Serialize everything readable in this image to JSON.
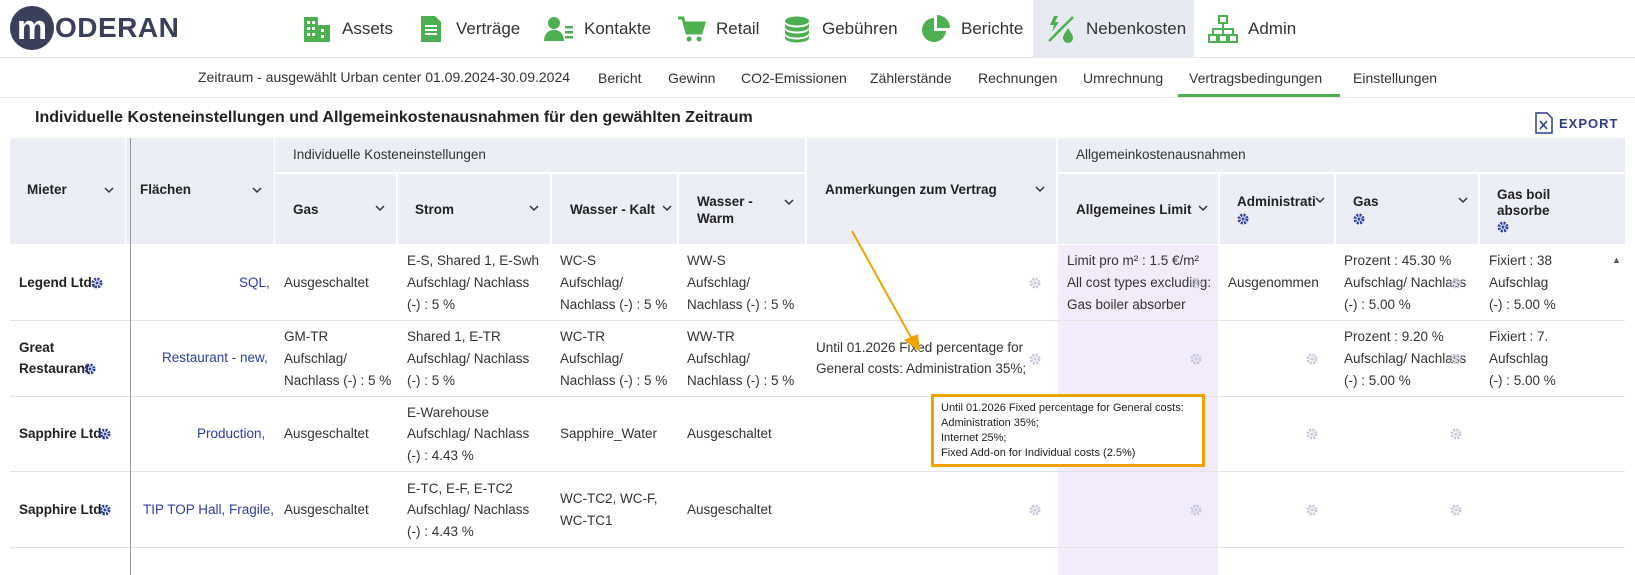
{
  "nav": {
    "logo_letter": "m",
    "logo_text": "ODERAN",
    "items": [
      {
        "label": "Assets",
        "icon": "buildings-icon"
      },
      {
        "label": "Verträge",
        "icon": "document-icon"
      },
      {
        "label": "Kontakte",
        "icon": "contacts-icon"
      },
      {
        "label": "Retail",
        "icon": "cart-icon"
      },
      {
        "label": "Gebühren",
        "icon": "coins-icon"
      },
      {
        "label": "Berichte",
        "icon": "pie-chart-icon"
      },
      {
        "label": "Nebenkosten",
        "icon": "utilities-icon"
      },
      {
        "label": "Admin",
        "icon": "org-chart-icon"
      }
    ],
    "active": "Nebenkosten",
    "accent": "#4caf50"
  },
  "subnav": {
    "period": "Zeitraum - ausgewählt Urban center 01.09.2024-30.09.2024",
    "items": [
      "Bericht",
      "Gewinn",
      "CO2-Emissionen",
      "Zählerstände",
      "Rechnungen",
      "Umrechnung",
      "Vertragsbedingungen",
      "Einstellungen"
    ],
    "active": "Vertragsbedingungen"
  },
  "page": {
    "title": "Individuelle Kosteneinstellungen und Allgemeinkostenausnahmen für den gewählten Zeitraum",
    "export_label": "EXPORT"
  },
  "table": {
    "group_individual": "Individuelle Kosteneinstellungen",
    "group_general": "Allgemeinkostenausnahmen",
    "col_mieter": "Mieter",
    "col_flaechen": "Flächen",
    "col_gas": "Gas",
    "col_strom": "Strom",
    "col_wasser_kalt": "Wasser - Kalt",
    "col_wasser_warm_1": "Wasser -",
    "col_wasser_warm_2": "Warm",
    "col_anmerkungen": "Anmerkungen zum Vertrag",
    "col_limit": "Allgemeines Limit",
    "col_admin": "Administrati",
    "col_gas2": "Gas",
    "col_gasboiler_1": "Gas boil",
    "col_gasboiler_2": "absorbe",
    "rows": [
      {
        "mieter": "Legend Ltd.",
        "flaechen": "SQL,",
        "gas": [
          "Ausgeschaltet"
        ],
        "strom": [
          "E-S, Shared 1, E-Swh",
          "Aufschlag/ Nachlass",
          "(-) : 5 %"
        ],
        "kalt": [
          "WC-S",
          "Aufschlag/",
          "Nachlass (-) : 5 %"
        ],
        "warm": [
          "WW-S",
          "Aufschlag/",
          "Nachlass (-) : 5 %"
        ],
        "anmerkung": [
          "",
          ""
        ],
        "limit": [
          "Limit pro m² : 1.5 €/m²",
          "All cost types excluding:",
          "Gas boiler absorber"
        ],
        "admin": [
          "Ausgenommen"
        ],
        "gas2": [
          "Prozent : 45.30 %",
          "Aufschlag/ Nachlass",
          "(-) : 5.00 %"
        ],
        "boiler": [
          "Fixiert : 38",
          "Aufschlag",
          "(-) : 5.00 %"
        ]
      },
      {
        "mieter_1": "Great",
        "mieter_2": "Restaurant",
        "flaechen": "Restaurant - new,",
        "gas": [
          "GM-TR",
          "Aufschlag/",
          "Nachlass (-) : 5 %"
        ],
        "strom": [
          "Shared 1, E-TR",
          "Aufschlag/ Nachlass",
          "(-) : 5 %"
        ],
        "kalt": [
          "WC-TR",
          "Aufschlag/",
          "Nachlass (-) : 5 %"
        ],
        "warm": [
          "WW-TR",
          "Aufschlag/",
          "Nachlass (-) : 5 %"
        ],
        "anmerkung": [
          "Until 01.2026 Fixed percentage for",
          "General costs: Administration 35%;..."
        ],
        "limit": [],
        "admin": [],
        "gas2": [
          "Prozent : 9.20 %",
          "Aufschlag/ Nachlass",
          "(-) : 5.00 %"
        ],
        "boiler": [
          "Fixiert : 7.",
          "Aufschlag",
          "(-) : 5.00 %"
        ]
      },
      {
        "mieter": "Sapphire Ltd.",
        "flaechen": "Production,",
        "gas": [
          "Ausgeschaltet"
        ],
        "strom": [
          "E-Warehouse",
          "Aufschlag/ Nachlass",
          "(-) : 4.43 %"
        ],
        "kalt": [
          "Sapphire_Water"
        ],
        "warm": [
          "Ausgeschaltet"
        ]
      },
      {
        "mieter": "Sapphire Ltd.",
        "flaechen": "TIP TOP Hall, Fragile,",
        "gas": [
          "Ausgeschaltet"
        ],
        "strom": [
          "E-TC, E-F, E-TC2",
          "Aufschlag/ Nachlass",
          "(-) : 4.43 %"
        ],
        "kalt": [
          "WC-TC2, WC-F,",
          "WC-TC1"
        ],
        "warm": [
          "Ausgeschaltet"
        ]
      }
    ]
  },
  "tooltip": {
    "lines": [
      "Until 01.2026 Fixed percentage for General costs:",
      "Administration 35%;",
      "Internet 25%;",
      "Fixed Add-on for Individual costs (2.5%)"
    ],
    "border_color": "#f0a300"
  }
}
